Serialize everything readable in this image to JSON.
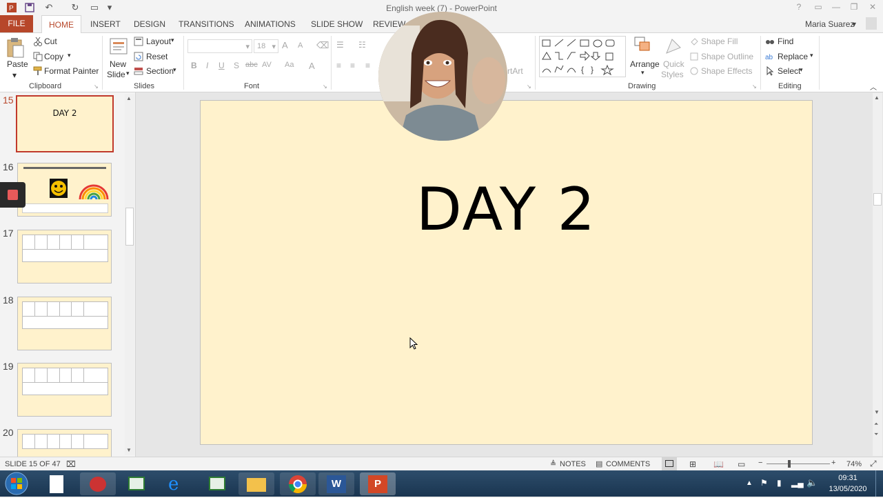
{
  "window": {
    "title": "English  week (7) - PowerPoint"
  },
  "tabs": [
    "FILE",
    "HOME",
    "INSERT",
    "DESIGN",
    "TRANSITIONS",
    "ANIMATIONS",
    "SLIDE SHOW",
    "REVIEW"
  ],
  "user": "Maria Suarez",
  "ribbon": {
    "clipboard": {
      "paste": "Paste",
      "cut": "Cut",
      "copy": "Copy",
      "format_painter": "Format Painter",
      "label": "Clipboard"
    },
    "slides": {
      "new_slide_1": "New",
      "new_slide_2": "Slide",
      "layout": "Layout",
      "reset": "Reset",
      "section": "Section",
      "label": "Slides"
    },
    "font": {
      "size": "18",
      "label": "Font"
    },
    "drawing": {
      "arrange": "Arrange",
      "quick_styles_1": "Quick",
      "quick_styles_2": "Styles",
      "shape_fill": "Shape Fill",
      "shape_outline": "Shape Outline",
      "shape_effects": "Shape Effects",
      "label": "Drawing",
      "artext": "rtArt"
    },
    "editing": {
      "find": "Find",
      "replace": "Replace",
      "select": "Select",
      "label": "Editing"
    }
  },
  "thumbnails": [
    {
      "num": "15",
      "title": "DAY 2"
    },
    {
      "num": "16"
    },
    {
      "num": "17"
    },
    {
      "num": "18"
    },
    {
      "num": "19"
    },
    {
      "num": "20"
    }
  ],
  "slide": {
    "title": "DAY 2"
  },
  "status": {
    "slide_info": "SLIDE 15 OF 47",
    "notes": "NOTES",
    "comments": "COMMENTS",
    "zoom": "74%"
  },
  "taskbar": {
    "time": "09:31",
    "date": "13/05/2020"
  },
  "colors": {
    "accent": "#b7472a",
    "slide_bg": "#fff2cc",
    "taskbar": "#1f3b57"
  }
}
